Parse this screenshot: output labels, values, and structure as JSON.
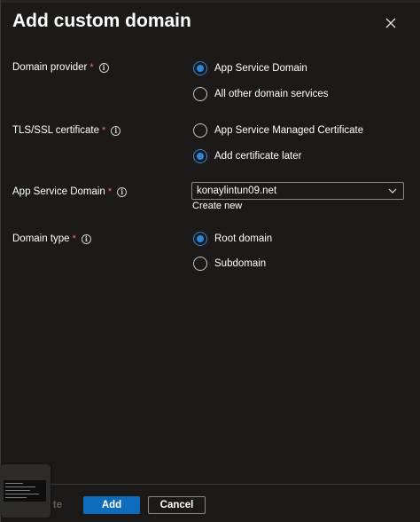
{
  "header": {
    "title": "Add custom domain"
  },
  "form": {
    "domain_provider": {
      "label": "Domain provider",
      "required_mark": "*",
      "options": [
        "App Service Domain",
        "All other domain services"
      ],
      "selected": "App Service Domain"
    },
    "tls_certificate": {
      "label": "TLS/SSL certificate",
      "required_mark": "*",
      "options": [
        "App Service Managed Certificate",
        "Add certificate later"
      ],
      "selected": "Add certificate later"
    },
    "app_service_domain": {
      "label": "App Service Domain",
      "required_mark": "*",
      "value": "konaylintun09.net",
      "create_new_link": "Create new"
    },
    "domain_type": {
      "label": "Domain type",
      "required_mark": "*",
      "options": [
        "Root domain",
        "Subdomain"
      ],
      "selected": "Root domain"
    }
  },
  "footer": {
    "previous_label": "te",
    "add_label": "Add",
    "cancel_label": "Cancel"
  },
  "colors": {
    "background": "#1b1a19",
    "accent": "#0f6cbd",
    "radio_selected": "#2b88d8",
    "required": "#f1707b"
  }
}
